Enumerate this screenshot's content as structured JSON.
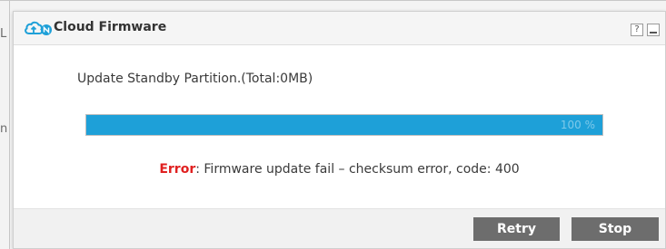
{
  "dialog": {
    "title": "Cloud Firmware",
    "help_label": "?",
    "status_text": "Update Standby Partition.(Total:0MB)",
    "progress_percent": 100,
    "progress_label": "100 %",
    "error_label": "Error",
    "error_message": ": Firmware update fail – checksum error, code: 400",
    "buttons": {
      "retry": "Retry",
      "stop": "Stop"
    }
  },
  "colors": {
    "progress_fill": "#1ea0d8",
    "error": "#e02020",
    "button_bg": "#6d6d6d",
    "icon": "#1ea0d8"
  },
  "icons": {
    "title_icon": "cloud-upload-icon"
  }
}
